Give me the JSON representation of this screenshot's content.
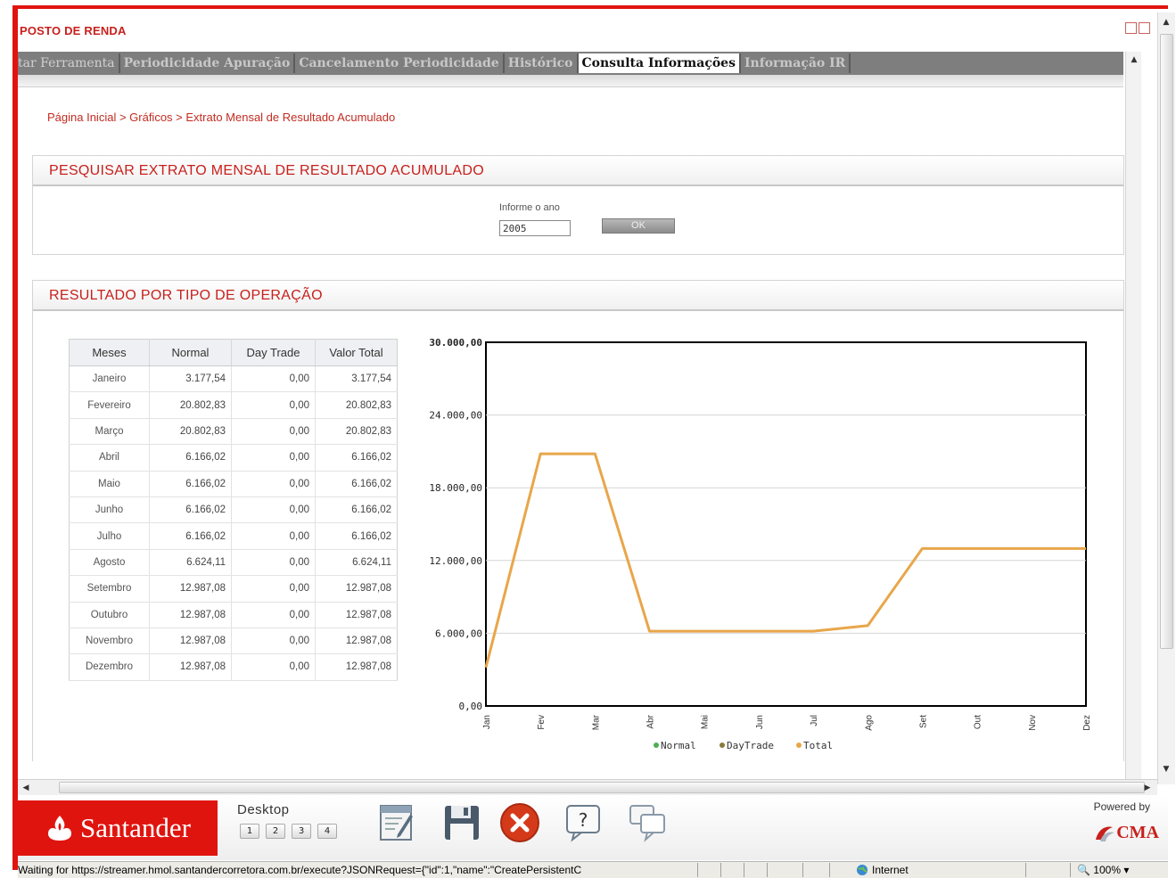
{
  "window": {
    "title": "POSTO DE RENDA"
  },
  "tabs": [
    {
      "label": "tar Ferramenta",
      "active": false
    },
    {
      "label": "Periodicidade Apuração",
      "active": false
    },
    {
      "label": "Cancelamento Periodicidade",
      "active": false
    },
    {
      "label": "Histórico",
      "active": false
    },
    {
      "label": "Consulta Informações",
      "active": true
    },
    {
      "label": "Informação IR",
      "active": false
    }
  ],
  "breadcrumb": "Página Inicial > Gráficos > Extrato Mensal de Resultado Acumulado",
  "search_section": {
    "title": "PESQUISAR EXTRATO MENSAL DE RESULTADO ACUMULADO",
    "year_label": "Informe o ano",
    "year_value": "2005",
    "ok_label": "OK"
  },
  "result_section": {
    "title": "RESULTADO POR TIPO DE OPERAÇÃO"
  },
  "table": {
    "headers": [
      "Meses",
      "Normal",
      "Day Trade",
      "Valor Total"
    ],
    "rows": [
      [
        "Janeiro",
        "3.177,54",
        "0,00",
        "3.177,54"
      ],
      [
        "Fevereiro",
        "20.802,83",
        "0,00",
        "20.802,83"
      ],
      [
        "Março",
        "20.802,83",
        "0,00",
        "20.802,83"
      ],
      [
        "Abril",
        "6.166,02",
        "0,00",
        "6.166,02"
      ],
      [
        "Maio",
        "6.166,02",
        "0,00",
        "6.166,02"
      ],
      [
        "Junho",
        "6.166,02",
        "0,00",
        "6.166,02"
      ],
      [
        "Julho",
        "6.166,02",
        "0,00",
        "6.166,02"
      ],
      [
        "Agosto",
        "6.624,11",
        "0,00",
        "6.624,11"
      ],
      [
        "Setembro",
        "12.987,08",
        "0,00",
        "12.987,08"
      ],
      [
        "Outubro",
        "12.987,08",
        "0,00",
        "12.987,08"
      ],
      [
        "Novembro",
        "12.987,08",
        "0,00",
        "12.987,08"
      ],
      [
        "Dezembro",
        "12.987,08",
        "0,00",
        "12.987,08"
      ]
    ]
  },
  "chart_data": {
    "type": "line",
    "categories": [
      "Jan",
      "Fev",
      "Mar",
      "Abr",
      "Mai",
      "Jun",
      "Jul",
      "Ago",
      "Set",
      "Out",
      "Nov",
      "Dez"
    ],
    "series": [
      {
        "name": "Normal",
        "values": [
          3177.54,
          20802.83,
          20802.83,
          6166.02,
          6166.02,
          6166.02,
          6166.02,
          6624.11,
          12987.08,
          12987.08,
          12987.08,
          12987.08
        ],
        "color": "#4caf50"
      },
      {
        "name": "DayTrade",
        "values": [
          0,
          0,
          0,
          0,
          0,
          0,
          0,
          0,
          0,
          0,
          0,
          0
        ],
        "color": "#8a7a3a"
      },
      {
        "name": "Total",
        "values": [
          3177.54,
          20802.83,
          20802.83,
          6166.02,
          6166.02,
          6166.02,
          6166.02,
          6624.11,
          12987.08,
          12987.08,
          12987.08,
          12987.08
        ],
        "color": "#e8a64a"
      }
    ],
    "yticks": [
      "0,00",
      "6.000,00",
      "12.000,00",
      "18.000,00",
      "24.000,00",
      "30.000,00"
    ],
    "ylim": [
      0,
      30000
    ],
    "grid": true,
    "legend": "bottom",
    "xlabel": "",
    "ylabel": ""
  },
  "footer": {
    "brand": "Santander",
    "desktop_label": "Desktop",
    "desktop_pages": [
      "1",
      "2",
      "3",
      "4"
    ],
    "powered_by": "Powered by",
    "cma": "CMA",
    "icons": [
      "notes-icon",
      "save-icon",
      "close-icon",
      "help-icon",
      "chat-icon"
    ]
  },
  "statusbar": {
    "text": "Waiting for https://streamer.hmol.santandercorretora.com.br/execute?JSONRequest={\"id\":1,\"name\":\"CreatePersistentC",
    "zone": "Internet",
    "zoom": "100%"
  },
  "colors": {
    "brand_red": "#e0140f",
    "line_total": "#e8a64a",
    "title_red": "#c8201c"
  }
}
